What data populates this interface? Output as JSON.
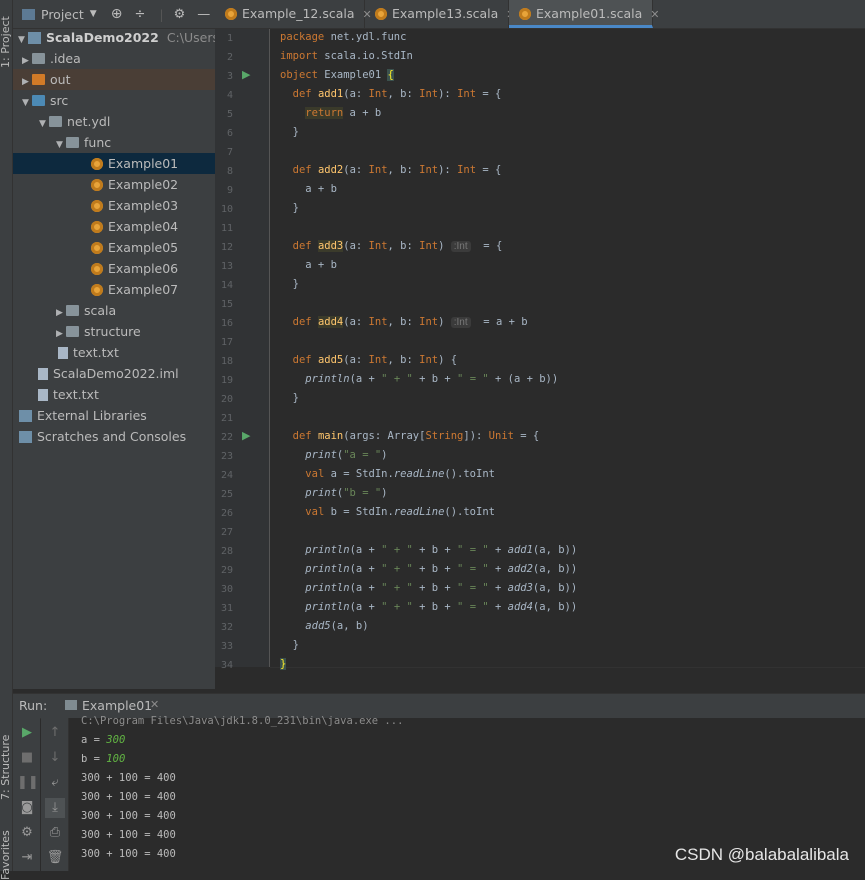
{
  "sidebar_strip": {
    "project": "1: Project",
    "structure": "7: Structure",
    "favorites": "Favorites"
  },
  "project_panel": {
    "title": "Project",
    "root": {
      "name": "ScalaDemo2022",
      "path": "C:\\Users\\ydl\\"
    },
    "items": [
      ".idea",
      "out",
      "src",
      "net.ydl",
      "func",
      "Example01",
      "Example02",
      "Example03",
      "Example04",
      "Example05",
      "Example06",
      "Example07",
      "scala",
      "structure",
      "text.txt",
      "ScalaDemo2022.iml",
      "text.txt",
      "External Libraries",
      "Scratches and Consoles"
    ]
  },
  "tabs": [
    {
      "label": "Example_12.scala"
    },
    {
      "label": "Example13.scala"
    },
    {
      "label": "Example01.scala",
      "active": true
    }
  ],
  "editor": {
    "line_numbers": [
      "1",
      "2",
      "3",
      "4",
      "5",
      "6",
      "7",
      "8",
      "9",
      "10",
      "11",
      "12",
      "13",
      "14",
      "15",
      "16",
      "17",
      "18",
      "19",
      "20",
      "21",
      "22",
      "23",
      "24",
      "25",
      "26",
      "27",
      "28",
      "29",
      "30",
      "31",
      "32",
      "33",
      "34"
    ],
    "hint_type": ":Int"
  },
  "run": {
    "label": "Run:",
    "tab": "Example01",
    "console": [
      "C:\\Program Files\\Java\\jdk1.8.0_231\\bin\\java.exe ...",
      "a = ",
      "300",
      "b = ",
      "100",
      "300 + 100 = 400",
      "300 + 100 = 400",
      "300 + 100 = 400",
      "300 + 100 = 400",
      "300 + 100 = 400"
    ]
  },
  "watermark": "CSDN @balabalalibala",
  "colors": {
    "keyword": "#cc7832",
    "string": "#6a8759",
    "selection": "#0d293e",
    "tab_accent": "#4a88c7"
  }
}
